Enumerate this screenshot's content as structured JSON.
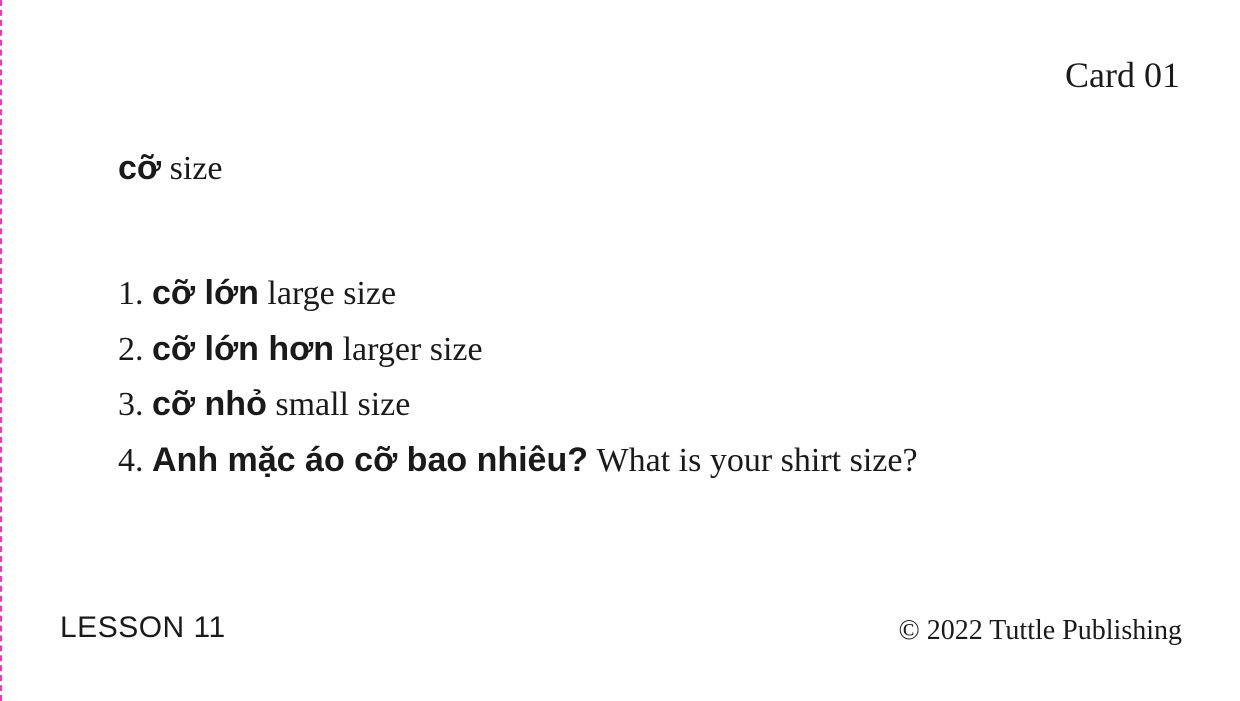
{
  "card": {
    "label": "Card 01"
  },
  "headword": {
    "vietnamese": "cỡ",
    "english": "size"
  },
  "examples": [
    {
      "number": "1.",
      "vietnamese": "cỡ lớn",
      "english": "large size"
    },
    {
      "number": "2.",
      "vietnamese": "cỡ lớn hơn",
      "english": "larger size"
    },
    {
      "number": "3.",
      "vietnamese": "cỡ nhỏ",
      "english": "small size"
    },
    {
      "number": "4.",
      "vietnamese": "Anh mặc áo cỡ bao nhiêu?",
      "english": "What is your shirt size?"
    }
  ],
  "footer": {
    "lesson": "LESSON 11",
    "copyright": "© 2022 Tuttle Publishing"
  },
  "colors": {
    "text": "#1a1a1a",
    "trim_line": "#e040b0",
    "background": "#ffffff"
  }
}
